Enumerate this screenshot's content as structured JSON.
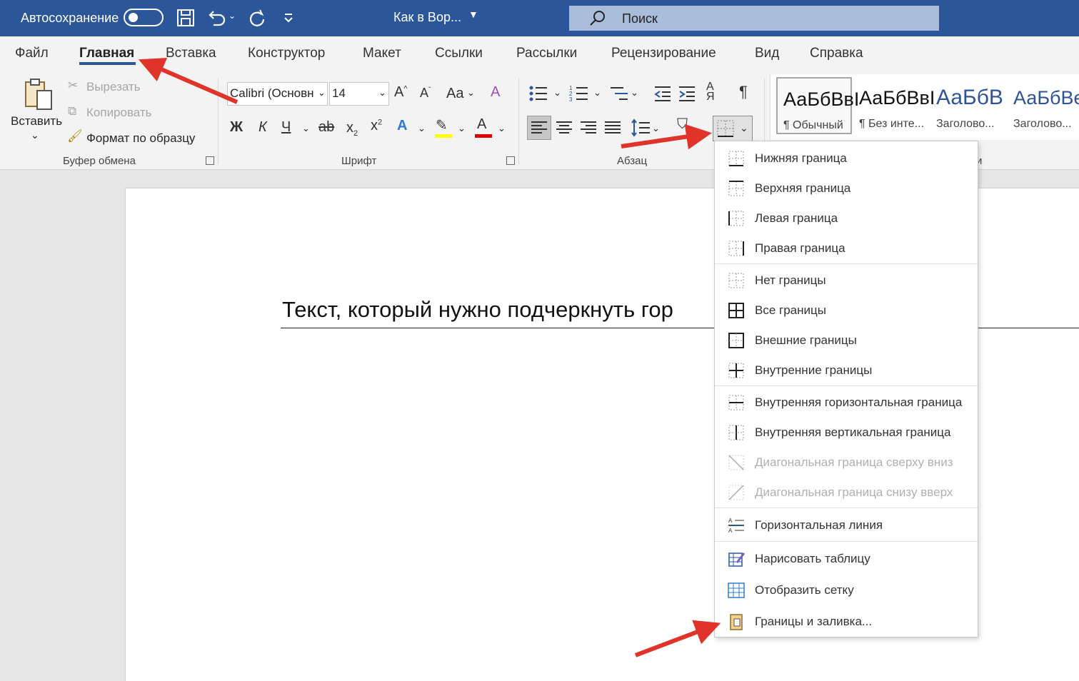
{
  "titlebar": {
    "autosave_label": "Автосохранение",
    "doc_title": "Как в Вор...",
    "search_placeholder": "Поиск"
  },
  "tabs": [
    {
      "label": "Файл"
    },
    {
      "label": "Главная",
      "active": true
    },
    {
      "label": "Вставка"
    },
    {
      "label": "Конструктор"
    },
    {
      "label": "Макет"
    },
    {
      "label": "Ссылки"
    },
    {
      "label": "Рассылки"
    },
    {
      "label": "Рецензирование"
    },
    {
      "label": "Вид"
    },
    {
      "label": "Справка"
    }
  ],
  "clipboard": {
    "paste": "Вставить",
    "cut": "Вырезать",
    "copy": "Копировать",
    "format_painter": "Формат по образцу",
    "group_label": "Буфер обмена"
  },
  "font": {
    "font_name": "Calibri (Основн",
    "font_size": "14",
    "bold": "Ж",
    "italic": "К",
    "underline": "Ч",
    "strike": "ab",
    "case": "Aa",
    "group_label": "Шрифт"
  },
  "paragraph": {
    "pilcrow": "¶",
    "group_label": "Абзац"
  },
  "styles": [
    {
      "sample": "АаБбВвI",
      "name": "¶ Обычный"
    },
    {
      "sample": "АаБбВвI",
      "name": "¶ Без инте..."
    },
    {
      "sample": "АаБбВ",
      "name": "Заголово..."
    },
    {
      "sample": "АаБбВе",
      "name": "Заголово..."
    }
  ],
  "styles_group_label_tail": "и",
  "document": {
    "text": "Текст, который нужно подчеркнуть гор"
  },
  "borders_menu": {
    "items": [
      {
        "label": "Нижняя граница",
        "icon": "bottom-border-icon",
        "disabled": false
      },
      {
        "label": "Верхняя граница",
        "icon": "top-border-icon",
        "disabled": false
      },
      {
        "label": "Левая граница",
        "icon": "left-border-icon",
        "disabled": false
      },
      {
        "label": "Правая граница",
        "icon": "right-border-icon",
        "disabled": false
      },
      {
        "label": "Нет границы",
        "icon": "no-border-icon",
        "disabled": false
      },
      {
        "label": "Все границы",
        "icon": "all-borders-icon",
        "disabled": false
      },
      {
        "label": "Внешние границы",
        "icon": "outside-borders-icon",
        "disabled": false
      },
      {
        "label": "Внутренние границы",
        "icon": "inside-borders-icon",
        "disabled": false
      },
      {
        "label": "Внутренняя горизонтальная граница",
        "icon": "inside-horizontal-border-icon",
        "disabled": false
      },
      {
        "label": "Внутренняя вертикальная граница",
        "icon": "inside-vertical-border-icon",
        "disabled": false
      },
      {
        "label": "Диагональная граница сверху вниз",
        "icon": "diagonal-down-border-icon",
        "disabled": true
      },
      {
        "label": "Диагональная граница снизу вверх",
        "icon": "diagonal-up-border-icon",
        "disabled": true
      },
      {
        "label": "Горизонтальная линия",
        "icon": "horizontal-line-icon",
        "disabled": false
      },
      {
        "label": "Нарисовать таблицу",
        "icon": "draw-table-icon",
        "disabled": false
      },
      {
        "label": "Отобразить сетку",
        "icon": "view-gridlines-icon",
        "disabled": false
      },
      {
        "label": "Границы и заливка...",
        "icon": "borders-and-shading-icon",
        "disabled": false
      }
    ]
  },
  "colors": {
    "titlebar": "#2b579a",
    "arrow": "#e0342b",
    "highlight_yellow": "#ffff00",
    "font_red": "#e00000",
    "accent_blue": "#2b579a"
  }
}
